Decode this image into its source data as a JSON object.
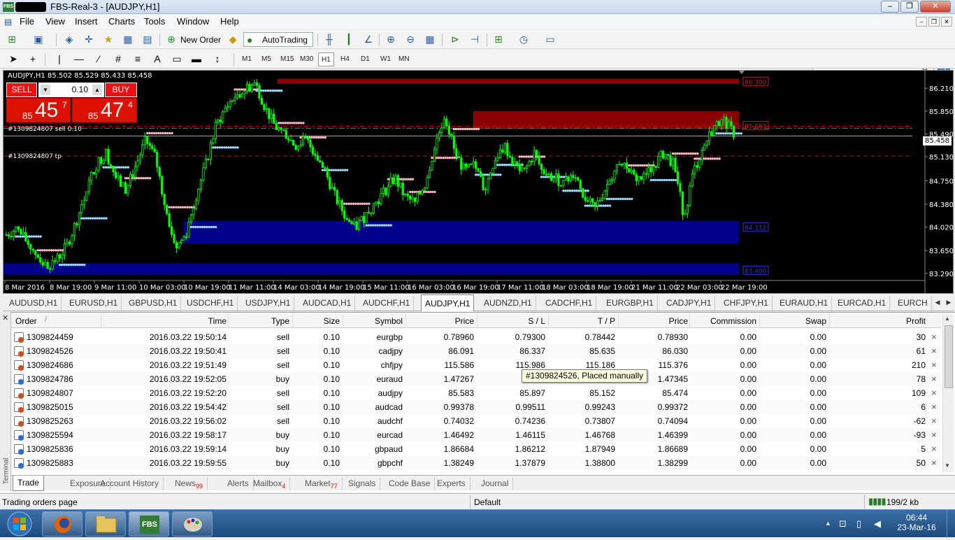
{
  "window": {
    "title": "FBS-Real-3 - [AUDJPY,H1]",
    "app_icon": "FBS",
    "controls": {
      "minimize": "–",
      "maximize": "❐",
      "close": "✕"
    }
  },
  "menu": {
    "items": [
      "File",
      "View",
      "Insert",
      "Charts",
      "Tools",
      "Window",
      "Help"
    ],
    "mdi": {
      "minimize": "–",
      "restore": "❐",
      "close": "✕"
    }
  },
  "toolbar1": {
    "new_order": "New Order",
    "autotrading": "AutoTrading"
  },
  "toolbar2": {
    "timeframes": [
      "M1",
      "M5",
      "M15",
      "M30",
      "H1",
      "H4",
      "D1",
      "W1",
      "MN"
    ],
    "active_timeframe": "H1",
    "drawing_text": "A"
  },
  "search": {
    "placeholder": ""
  },
  "chart": {
    "info": "AUDJPY,H1  85.502 85.529 85.433 85.458",
    "sell_label": "SELL",
    "buy_label": "BUY",
    "lot": "0.10",
    "sell_price": {
      "small": "85",
      "big": "45",
      "sup": "7"
    },
    "buy_price": {
      "small": "85",
      "big": "47",
      "sup": "4"
    },
    "order_label_1": "#1309824807 sell 0.10",
    "order_label_2": "#1309824807 tp",
    "current_price": "85.458",
    "zone_labels": [
      "86.300",
      "85.883",
      "84.112",
      "83.400"
    ]
  },
  "chart_data": {
    "type": "candlestick",
    "symbol": "AUDJPY",
    "timeframe": "H1",
    "y_ticks": [
      "86.210",
      "85.850",
      "85.490",
      "85.130",
      "84.750",
      "84.380",
      "84.020",
      "83.650",
      "83.290"
    ],
    "x_ticks": [
      "8 Mar 2016",
      "8 Mar 19:00",
      "9 Mar 11:00",
      "10 Mar 03:00",
      "10 Mar 19:00",
      "11 Mar 11:00",
      "14 Mar 03:00",
      "14 Mar 19:00",
      "15 Mar 11:00",
      "16 Mar 03:00",
      "16 Mar 19:00",
      "17 Mar 11:00",
      "18 Mar 03:00",
      "18 Mar 19:00",
      "21 Mar 11:00",
      "22 Mar 03:00",
      "22 Mar 19:00"
    ],
    "ylim": [
      83.2,
      86.4
    ],
    "close_path": [
      83.9,
      84.0,
      83.8,
      83.6,
      83.4,
      83.5,
      83.7,
      84.1,
      84.6,
      85.0,
      85.2,
      84.8,
      84.6,
      85.0,
      85.4,
      85.1,
      84.3,
      83.7,
      83.9,
      84.5,
      85.0,
      85.6,
      85.9,
      86.1,
      86.2,
      86.3,
      85.9,
      85.6,
      85.5,
      85.3,
      85.4,
      85.2,
      84.9,
      84.5,
      84.2,
      84.0,
      84.2,
      84.4,
      84.6,
      84.8,
      84.5,
      84.4,
      84.7,
      85.3,
      85.8,
      85.2,
      84.9,
      85.0,
      84.6,
      85.1,
      85.3,
      85.0,
      84.9,
      85.2,
      84.8,
      84.8,
      84.7,
      84.9,
      84.5,
      84.3,
      84.6,
      84.9,
      85.0,
      84.8,
      84.8,
      85.0,
      85.2,
      85.0,
      84.2,
      84.9,
      85.3,
      85.6,
      85.7,
      85.5
    ],
    "resistance_zones": [
      [
        86.28,
        86.36
      ],
      [
        85.57,
        85.85
      ]
    ],
    "support_zones": [
      [
        83.76,
        84.12
      ],
      [
        83.27,
        83.45
      ]
    ],
    "h_lines": {
      "sell_entry": 85.61,
      "tp": 85.14,
      "green_dashdot": 85.58,
      "current": 85.458
    }
  },
  "chart_tabs": {
    "items": [
      "AUDUSD,H1",
      "EURUSD,H1",
      "GBPUSD,H1",
      "USDCHF,H1",
      "USDJPY,H1",
      "AUDCAD,H1",
      "AUDCHF,H1",
      "AUDJPY,H1",
      "AUDNZD,H1",
      "CADCHF,H1",
      "EURGBP,H1",
      "CADJPY,H1",
      "CHFJPY,H1",
      "EURAUD,H1",
      "EURCAD,H1",
      "EURCH"
    ],
    "active": "AUDJPY,H1"
  },
  "terminal": {
    "side_title": "Terminal",
    "close": "✕",
    "columns": [
      "Order",
      "Time",
      "Type",
      "Size",
      "Symbol",
      "Price",
      "S / L",
      "T / P",
      "Price",
      "Commission",
      "Swap",
      "Profit"
    ],
    "sort_indicator": "/",
    "orders": [
      {
        "order": "1309824459",
        "time": "2016.03.22 19:50:14",
        "type": "sell",
        "size": "0.10",
        "symbol": "eurgbp",
        "price": "0.78960",
        "sl": "0.79300",
        "tp": "0.78442",
        "cur": "0.78930",
        "commission": "0.00",
        "swap": "0.00",
        "profit": "30"
      },
      {
        "order": "1309824526",
        "time": "2016.03.22 19:50:41",
        "type": "sell",
        "size": "0.10",
        "symbol": "cadjpy",
        "price": "86.091",
        "sl": "86.337",
        "tp": "85.635",
        "cur": "86.030",
        "commission": "0.00",
        "swap": "0.00",
        "profit": "61"
      },
      {
        "order": "1309824686",
        "time": "2016.03.22 19:51:49",
        "type": "sell",
        "size": "0.10",
        "symbol": "chfjpy",
        "price": "115.586",
        "sl": "115.986",
        "tp": "115.186",
        "cur": "115.376",
        "commission": "0.00",
        "swap": "0.00",
        "profit": "210"
      },
      {
        "order": "1309824786",
        "time": "2016.03.22 19:52:05",
        "type": "buy",
        "size": "0.10",
        "symbol": "euraud",
        "price": "1.47267",
        "sl": "1",
        "tp": "",
        "cur": "1.47345",
        "commission": "0.00",
        "swap": "0.00",
        "profit": "78"
      },
      {
        "order": "1309824807",
        "time": "2016.03.22 19:52:20",
        "type": "sell",
        "size": "0.10",
        "symbol": "audjpy",
        "price": "85.583",
        "sl": "85.897",
        "tp": "85.152",
        "cur": "85.474",
        "commission": "0.00",
        "swap": "0.00",
        "profit": "109"
      },
      {
        "order": "1309825015",
        "time": "2016.03.22 19:54:42",
        "type": "sell",
        "size": "0.10",
        "symbol": "audcad",
        "price": "0.99378",
        "sl": "0.99511",
        "tp": "0.99243",
        "cur": "0.99372",
        "commission": "0.00",
        "swap": "0.00",
        "profit": "6"
      },
      {
        "order": "1309825263",
        "time": "2016.03.22 19:56:02",
        "type": "sell",
        "size": "0.10",
        "symbol": "audchf",
        "price": "0.74032",
        "sl": "0.74236",
        "tp": "0.73807",
        "cur": "0.74094",
        "commission": "0.00",
        "swap": "0.00",
        "profit": "-62"
      },
      {
        "order": "1309825594",
        "time": "2016.03.22 19:58:17",
        "type": "buy",
        "size": "0.10",
        "symbol": "eurcad",
        "price": "1.46492",
        "sl": "1.46115",
        "tp": "1.46768",
        "cur": "1.46399",
        "commission": "0.00",
        "swap": "0.00",
        "profit": "-93"
      },
      {
        "order": "1309825836",
        "time": "2016.03.22 19:59:14",
        "type": "buy",
        "size": "0.10",
        "symbol": "gbpaud",
        "price": "1.86684",
        "sl": "1.86212",
        "tp": "1.87949",
        "cur": "1.86689",
        "commission": "0.00",
        "swap": "0.00",
        "profit": "5"
      },
      {
        "order": "1309825883",
        "time": "2016.03.22 19:59:55",
        "type": "buy",
        "size": "0.10",
        "symbol": "gbpchf",
        "price": "1.38249",
        "sl": "1.37879",
        "tp": "1.38800",
        "cur": "1.38299",
        "commission": "0.00",
        "swap": "0.00",
        "profit": "50"
      }
    ],
    "tooltip": "#1309824526, Placed manually",
    "tabs": [
      {
        "label": "Trade",
        "badge": ""
      },
      {
        "label": "Exposure",
        "badge": ""
      },
      {
        "label": "Account History",
        "badge": ""
      },
      {
        "label": "News",
        "badge": "99"
      },
      {
        "label": "Alerts",
        "badge": ""
      },
      {
        "label": "Mailbox",
        "badge": "4"
      },
      {
        "label": "Market",
        "badge": "77"
      },
      {
        "label": "Signals",
        "badge": ""
      },
      {
        "label": "Code Base",
        "badge": ""
      },
      {
        "label": "Experts",
        "badge": ""
      },
      {
        "label": "Journal",
        "badge": ""
      }
    ],
    "active_tab": "Trade"
  },
  "status": {
    "left": "Trading orders page",
    "profile": "Default",
    "traffic": "199/2 kb"
  },
  "taskbar": {
    "apps": [
      "start",
      "firefox",
      "explorer",
      "FBS",
      "paint"
    ],
    "fbs_label": "FBS",
    "time": "06:44",
    "date": "23-Mar-16"
  },
  "colors": {
    "chart_bg": "#000000",
    "candle": "#00ff00",
    "resistance_zone": "#8b0000",
    "support_zone": "#00008b",
    "sell_red": "#dd1111"
  }
}
